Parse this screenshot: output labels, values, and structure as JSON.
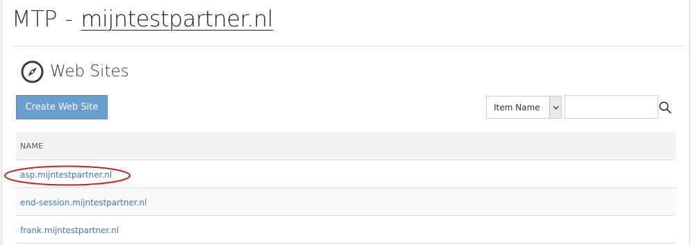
{
  "page_title": {
    "prefix": "MTP",
    "separator": "-",
    "domain": "mijntestpartner.nl"
  },
  "section": {
    "title": "Web Sites",
    "icon": "compass-icon"
  },
  "toolbar": {
    "create_label": "Create Web Site",
    "filter_selected": "Item Name",
    "search_value": "",
    "search_icon": "search-icon"
  },
  "table": {
    "columns": [
      "NAME"
    ],
    "rows": [
      {
        "name": "asp.mijntestpartner.nl"
      },
      {
        "name": "end-session.mijntestpartner.nl"
      },
      {
        "name": "frank.mijntestpartner.nl"
      }
    ]
  },
  "colors": {
    "button": "#6a9ed0",
    "link": "#3d7bbf",
    "annotation": "#cc1f1f"
  }
}
